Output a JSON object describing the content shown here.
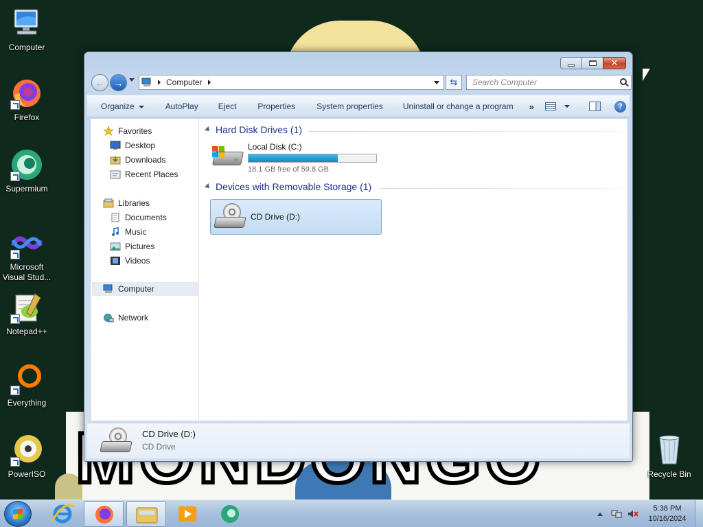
{
  "desktop": {
    "icons": [
      {
        "label": "Computer",
        "icon": "computer-icon"
      },
      {
        "label": "Firefox",
        "icon": "firefox-icon"
      },
      {
        "label": "Supermium",
        "icon": "supermium-icon"
      },
      {
        "label": "Microsoft Visual Stud...",
        "icon": "visual-studio-icon"
      },
      {
        "label": "Notepad++",
        "icon": "notepadpp-icon"
      },
      {
        "label": "Everything",
        "icon": "everything-icon"
      },
      {
        "label": "PowerISO",
        "icon": "poweriso-icon"
      },
      {
        "label": "Recycle Bin",
        "icon": "recycle-bin-icon"
      }
    ],
    "wallpaper_text": "MONDONGO"
  },
  "window": {
    "address": {
      "location": "Computer"
    },
    "search": {
      "placeholder": "Search Computer"
    },
    "toolbar": {
      "organize": "Organize",
      "autoplay": "AutoPlay",
      "eject": "Eject",
      "properties": "Properties",
      "system_properties": "System properties",
      "uninstall": "Uninstall or change a program",
      "more": "»"
    },
    "nav_pane": {
      "favorites": "Favorites",
      "desktop": "Desktop",
      "downloads": "Downloads",
      "recent_places": "Recent Places",
      "libraries": "Libraries",
      "documents": "Documents",
      "music": "Music",
      "pictures": "Pictures",
      "videos": "Videos",
      "computer": "Computer",
      "network": "Network"
    },
    "groups": {
      "hard_disk": {
        "header": "Hard Disk Drives (1)",
        "drive": {
          "name": "Local Disk (C:)",
          "free_text": "18.1 GB free of 59.8 GB",
          "used_fraction": 0.697
        }
      },
      "removable": {
        "header": "Devices with Removable Storage (1)",
        "drive": {
          "name": "CD Drive (D:)"
        }
      }
    },
    "details": {
      "title": "CD Drive (D:)",
      "subtitle": "CD Drive"
    }
  },
  "taskbar": {
    "apps": [
      "Internet Explorer",
      "Firefox",
      "Windows Explorer",
      "Windows Media Player",
      "Supermium"
    ],
    "clock": {
      "time": "5:38 PM",
      "date": "10/16/2024"
    }
  },
  "colors": {
    "accent": "#1e3287",
    "bar_fill": "#26a0da",
    "selection": "#c2dcf3"
  }
}
